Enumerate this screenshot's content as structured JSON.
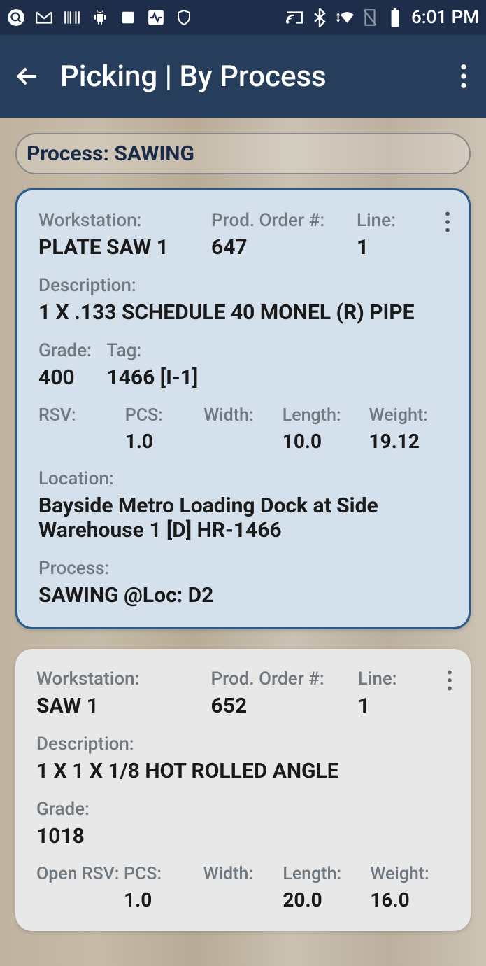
{
  "statusbar": {
    "time": "6:01 PM"
  },
  "appbar": {
    "title": "Picking | By Process"
  },
  "process": {
    "label": "Process: SAWING"
  },
  "labels": {
    "workstation": "Workstation:",
    "prodOrder": "Prod. Order #:",
    "line": "Line:",
    "description": "Description:",
    "grade": "Grade:",
    "tag": "Tag:",
    "rsv": "RSV:",
    "openRsv": "Open RSV:",
    "pcs": "PCS:",
    "width": "Width:",
    "length": "Length:",
    "weight": "Weight:",
    "location": "Location:",
    "process": "Process:"
  },
  "cards": [
    {
      "workstation": "PLATE SAW 1",
      "prodOrder": "647",
      "line": "1",
      "description": "1 X .133 SCHEDULE 40 MONEL (R) PIPE",
      "grade": "400",
      "tag": "1466  [I-1]",
      "rsv": "",
      "pcs": "1.0",
      "width": "",
      "length": "10.0",
      "weight": "19.12",
      "location": "Bayside Metro Loading Dock at Side Warehouse 1 [D] HR-1466",
      "process": "SAWING @Loc: D2"
    },
    {
      "workstation": "SAW 1",
      "prodOrder": "652",
      "line": "1",
      "description": "1 X 1 X 1/8 HOT ROLLED ANGLE",
      "grade": "1018",
      "pcs": "1.0",
      "width": "",
      "length": "20.0",
      "weight": "16.0"
    }
  ]
}
